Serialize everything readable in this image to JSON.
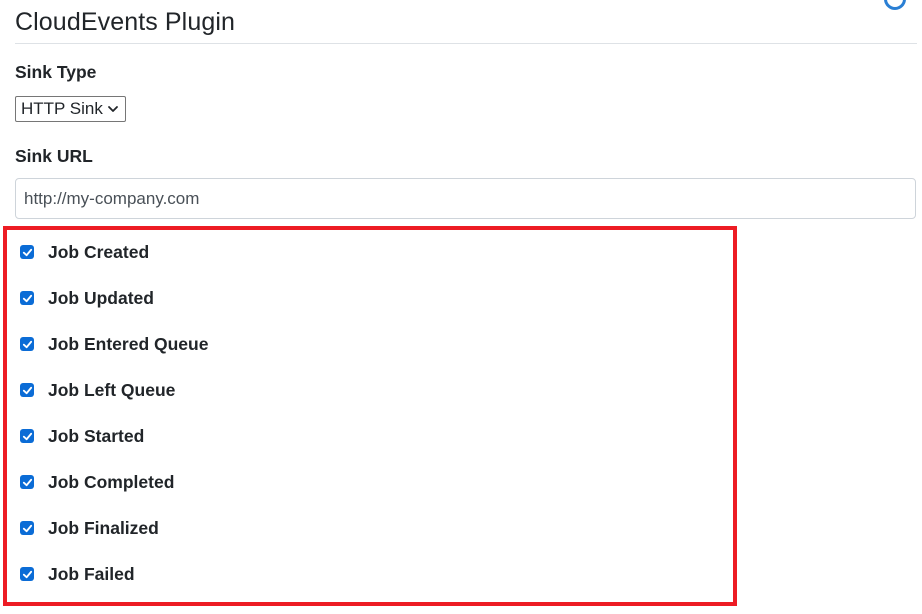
{
  "plugin": {
    "title": "CloudEvents Plugin"
  },
  "sink_type": {
    "label": "Sink Type",
    "selected": "HTTP Sink"
  },
  "sink_url": {
    "label": "Sink URL",
    "value": "http://my-company.com"
  },
  "events": [
    {
      "label": "Job Created",
      "checked": true
    },
    {
      "label": "Job Updated",
      "checked": true
    },
    {
      "label": "Job Entered Queue",
      "checked": true
    },
    {
      "label": "Job Left Queue",
      "checked": true
    },
    {
      "label": "Job Started",
      "checked": true
    },
    {
      "label": "Job Completed",
      "checked": true
    },
    {
      "label": "Job Finalized",
      "checked": true
    },
    {
      "label": "Job Failed",
      "checked": true
    }
  ],
  "colors": {
    "checkbox": "#0b6cd6",
    "highlight": "#ed1c24"
  }
}
